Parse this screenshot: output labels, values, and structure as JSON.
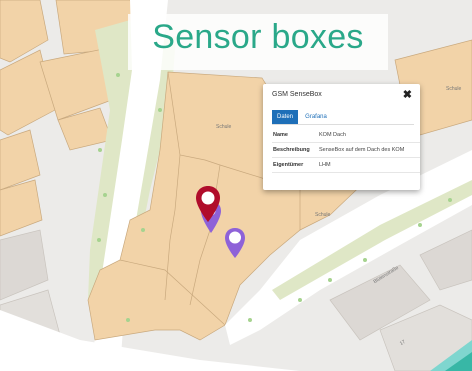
{
  "slide_title": "Sensor boxes",
  "popup": {
    "title": "GSM SenseBox",
    "close_glyph": "✖",
    "tabs": [
      {
        "label": "Daten"
      },
      {
        "label": "Grafana"
      }
    ],
    "rows": [
      {
        "key": "Name",
        "value": "KOM Dach"
      },
      {
        "key": "Beschreibung",
        "value": "SenseBox auf dem Dach des KOM"
      },
      {
        "key": "Eigentümer",
        "value": "LHM"
      }
    ]
  },
  "map_labels": {
    "schule_1": "Schule",
    "schule_2": "Schule",
    "schule_3": "Schule",
    "street": "Blütenstraße",
    "house_number": "17"
  },
  "colors": {
    "title": "#2aa889",
    "building": "#f2d3a8",
    "building_border": "#c9a97e",
    "tab_active": "#1e6fb8",
    "marker_red": "#b00d2b",
    "marker_purple": "#8e62d8",
    "marker_lavender": "#b59cf0"
  },
  "icons": {
    "close": "close-icon",
    "marker": "map-marker-icon"
  }
}
